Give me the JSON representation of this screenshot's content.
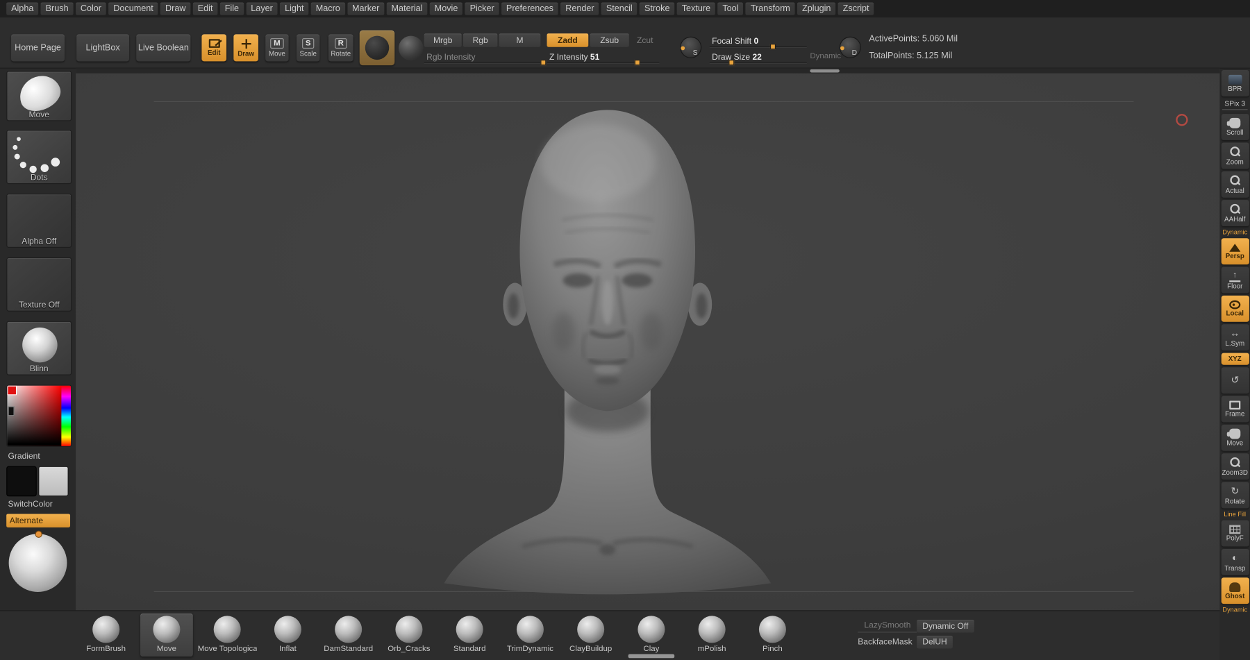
{
  "menu": {
    "items": [
      "Alpha",
      "Brush",
      "Color",
      "Document",
      "Draw",
      "Edit",
      "File",
      "Layer",
      "Light",
      "Macro",
      "Marker",
      "Material",
      "Movie",
      "Picker",
      "Preferences",
      "Render",
      "Stencil",
      "Stroke",
      "Texture",
      "Tool",
      "Transform",
      "Zplugin",
      "Zscript"
    ]
  },
  "toolbar": {
    "home_page": "Home Page",
    "lightbox": "LightBox",
    "live_boolean": "Live Boolean",
    "edit": "Edit",
    "draw": "Draw",
    "move": "Move",
    "scale": "Scale",
    "rotate": "Rotate",
    "mrgb": "Mrgb",
    "rgb": "Rgb",
    "m": "M",
    "zadd": "Zadd",
    "zsub": "Zsub",
    "zcut": "Zcut",
    "sliders": {
      "rgb_intensity": {
        "label": "Rgb Intensity",
        "value": ""
      },
      "z_intensity": {
        "label": "Z Intensity",
        "value": "51"
      },
      "focal_shift": {
        "label": "Focal Shift",
        "value": "0"
      },
      "draw_size": {
        "label": "Draw Size",
        "value": "22"
      }
    },
    "dynamic": "Dynamic",
    "stroke_curve": "S",
    "depth_curve": "D",
    "active_points": "ActivePoints: 5.060 Mil",
    "total_points": "TotalPoints: 5.125 Mil"
  },
  "left_panel": {
    "brush_name": "Move",
    "stroke_name": "Dots",
    "alpha_name": "Alpha Off",
    "texture_name": "Texture Off",
    "material_name": "Blinn",
    "gradient_label": "Gradient",
    "switch_color_label": "SwitchColor",
    "alternate_label": "Alternate"
  },
  "right_panel": {
    "items": [
      {
        "label": "BPR",
        "icon": "bpr"
      },
      {
        "label": "SPix 3",
        "icon": "none",
        "type": "slider"
      },
      {
        "label": "Scroll",
        "icon": "hand"
      },
      {
        "label": "Zoom",
        "icon": "magnifier"
      },
      {
        "label": "Actual",
        "icon": "magnifier"
      },
      {
        "label": "AAHalf",
        "icon": "magnifier"
      },
      {
        "label": "Persp",
        "icon": "persp",
        "active": true,
        "tag_above": "Dynamic"
      },
      {
        "label": "Floor",
        "icon": "floor"
      },
      {
        "label": "Local",
        "icon": "local",
        "active": true
      },
      {
        "label": "L.Sym",
        "icon": "sym"
      },
      {
        "label": "XYZ",
        "icon": "none",
        "type": "pill",
        "active": true
      },
      {
        "label": "",
        "icon": "history"
      },
      {
        "label": "Frame",
        "icon": "frame"
      },
      {
        "label": "Move",
        "icon": "hand"
      },
      {
        "label": "Zoom3D",
        "icon": "magnifier"
      },
      {
        "label": "Rotate",
        "icon": "rotate"
      },
      {
        "label": "PolyF",
        "icon": "grid",
        "tag_above": "Line Fill"
      },
      {
        "label": "Transp",
        "icon": "transp"
      },
      {
        "label": "Ghost",
        "icon": "ghost",
        "active": true,
        "tag_below": "Dynamic"
      }
    ]
  },
  "bottom_bar": {
    "brushes": [
      {
        "label": "FormBrush"
      },
      {
        "label": "Move",
        "selected": true
      },
      {
        "label": "Move Topological"
      },
      {
        "label": "Inflat"
      },
      {
        "label": "DamStandard"
      },
      {
        "label": "Orb_Cracks"
      },
      {
        "label": "Standard"
      },
      {
        "label": "TrimDynamic"
      },
      {
        "label": "ClayBuildup"
      },
      {
        "label": "Clay"
      },
      {
        "label": "mPolish"
      },
      {
        "label": "Pinch"
      }
    ],
    "lazy_smooth": "LazySmooth",
    "dynamic_off": "Dynamic Off",
    "backface_mask": "BackfaceMask",
    "del_uh": "DelUH"
  },
  "colors": {
    "accent": "#e8a33d",
    "panel_bg": "#2d2d2d",
    "canvas_bg": "#3e3e3e",
    "text": "#c9c9c9"
  }
}
